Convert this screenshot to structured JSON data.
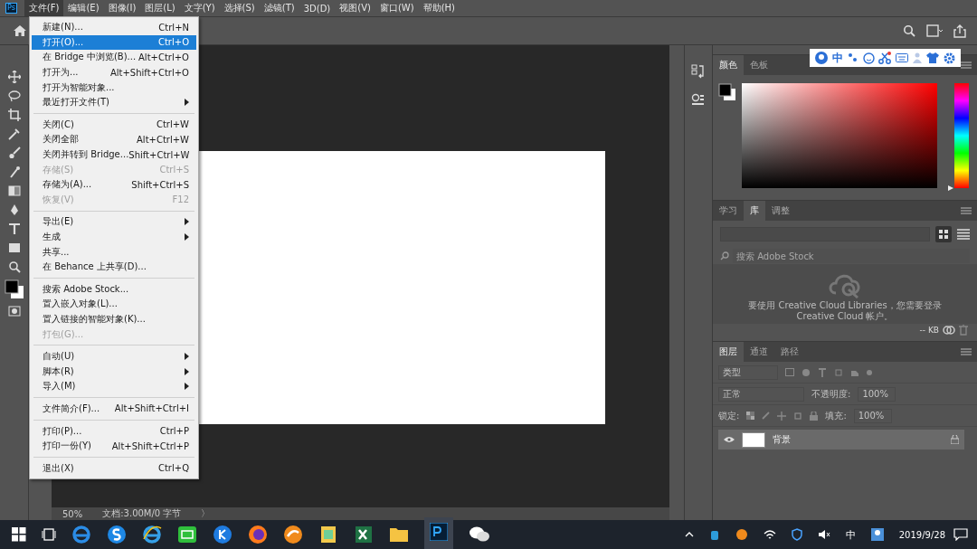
{
  "menubar": {
    "app_icon": "Ps",
    "items": [
      {
        "label": "文件(F)",
        "selected": true
      },
      {
        "label": "编辑(E)",
        "selected": false
      },
      {
        "label": "图像(I)",
        "selected": false
      },
      {
        "label": "图层(L)",
        "selected": false
      },
      {
        "label": "文字(Y)",
        "selected": false
      },
      {
        "label": "选择(S)",
        "selected": false
      },
      {
        "label": "滤镜(T)",
        "selected": false
      },
      {
        "label": "3D(D)",
        "selected": false
      },
      {
        "label": "视图(V)",
        "selected": false
      },
      {
        "label": "窗口(W)",
        "selected": false
      },
      {
        "label": "帮助(H)",
        "selected": false
      }
    ]
  },
  "file_menu": {
    "items": [
      {
        "kind": "item",
        "label": "新建(N)...",
        "shortcut": "Ctrl+N",
        "submenu": false,
        "disabled": false,
        "selected": false
      },
      {
        "kind": "item",
        "label": "打开(O)...",
        "shortcut": "Ctrl+O",
        "submenu": false,
        "disabled": false,
        "selected": true
      },
      {
        "kind": "item",
        "label": "在 Bridge 中浏览(B)...",
        "shortcut": "Alt+Ctrl+O",
        "submenu": false,
        "disabled": false,
        "selected": false
      },
      {
        "kind": "item",
        "label": "打开为...",
        "shortcut": "Alt+Shift+Ctrl+O",
        "submenu": false,
        "disabled": false,
        "selected": false
      },
      {
        "kind": "item",
        "label": "打开为智能对象...",
        "submenu": false,
        "disabled": false,
        "selected": false
      },
      {
        "kind": "item",
        "label": "最近打开文件(T)",
        "submenu": true,
        "disabled": false,
        "selected": false
      },
      {
        "kind": "separator"
      },
      {
        "kind": "item",
        "label": "关闭(C)",
        "shortcut": "Ctrl+W",
        "submenu": false,
        "disabled": false,
        "selected": false
      },
      {
        "kind": "item",
        "label": "关闭全部",
        "shortcut": "Alt+Ctrl+W",
        "submenu": false,
        "disabled": false,
        "selected": false
      },
      {
        "kind": "item",
        "label": "关闭并转到 Bridge...",
        "shortcut": "Shift+Ctrl+W",
        "submenu": false,
        "disabled": false,
        "selected": false
      },
      {
        "kind": "item",
        "label": "存储(S)",
        "shortcut": "Ctrl+S",
        "submenu": false,
        "disabled": true,
        "selected": false
      },
      {
        "kind": "item",
        "label": "存储为(A)...",
        "shortcut": "Shift+Ctrl+S",
        "submenu": false,
        "disabled": false,
        "selected": false
      },
      {
        "kind": "item",
        "label": "恢复(V)",
        "shortcut": "F12",
        "submenu": false,
        "disabled": true,
        "selected": false
      },
      {
        "kind": "separator"
      },
      {
        "kind": "item",
        "label": "导出(E)",
        "submenu": true,
        "disabled": false,
        "selected": false
      },
      {
        "kind": "item",
        "label": "生成",
        "submenu": true,
        "disabled": false,
        "selected": false
      },
      {
        "kind": "item",
        "label": "共享...",
        "submenu": false,
        "disabled": false,
        "selected": false
      },
      {
        "kind": "item",
        "label": "在 Behance 上共享(D)...",
        "submenu": false,
        "disabled": false,
        "selected": false
      },
      {
        "kind": "separator"
      },
      {
        "kind": "item",
        "label": "搜索 Adobe Stock...",
        "submenu": false,
        "disabled": false,
        "selected": false
      },
      {
        "kind": "item",
        "label": "置入嵌入对象(L)...",
        "submenu": false,
        "disabled": false,
        "selected": false
      },
      {
        "kind": "item",
        "label": "置入链接的智能对象(K)...",
        "submenu": false,
        "disabled": false,
        "selected": false
      },
      {
        "kind": "item",
        "label": "打包(G)...",
        "submenu": false,
        "disabled": true,
        "selected": false
      },
      {
        "kind": "separator"
      },
      {
        "kind": "item",
        "label": "自动(U)",
        "submenu": true,
        "disabled": false,
        "selected": false
      },
      {
        "kind": "item",
        "label": "脚本(R)",
        "submenu": true,
        "disabled": false,
        "selected": false
      },
      {
        "kind": "item",
        "label": "导入(M)",
        "submenu": true,
        "disabled": false,
        "selected": false
      },
      {
        "kind": "separator"
      },
      {
        "kind": "item",
        "label": "文件简介(F)...",
        "shortcut": "Alt+Shift+Ctrl+I",
        "submenu": false,
        "disabled": false,
        "selected": false
      },
      {
        "kind": "separator"
      },
      {
        "kind": "item",
        "label": "打印(P)...",
        "shortcut": "Ctrl+P",
        "submenu": false,
        "disabled": false,
        "selected": false
      },
      {
        "kind": "item",
        "label": "打印一份(Y)",
        "shortcut": "Alt+Shift+Ctrl+P",
        "submenu": false,
        "disabled": false,
        "selected": false
      },
      {
        "kind": "separator"
      },
      {
        "kind": "item",
        "label": "退出(X)",
        "shortcut": "Ctrl+Q",
        "submenu": false,
        "disabled": false,
        "selected": false
      }
    ]
  },
  "status_bar": {
    "zoom": "50%",
    "doc_info": "文档:3.00M/0 字节",
    "arrow": "〉"
  },
  "ime_toolbar": {
    "mode": "中"
  },
  "color_panel": {
    "tabs": [
      {
        "label": "颜色",
        "selected": true
      },
      {
        "label": "色板",
        "selected": false
      }
    ],
    "hue_slider": {
      "level": 0
    }
  },
  "library_panel": {
    "tabs": [
      {
        "label": "学习",
        "selected": false
      },
      {
        "label": "库",
        "selected": true
      },
      {
        "label": "调整",
        "selected": false
      }
    ],
    "search": {
      "placeholder": "搜索 Adobe Stock"
    },
    "message": "要使用 Creative Cloud Libraries，您需要登录 Creative Cloud 帐户。",
    "size": "-- KB"
  },
  "layers_panel": {
    "tabs": [
      {
        "label": "图层",
        "selected": true
      },
      {
        "label": "通道",
        "selected": false
      },
      {
        "label": "路径",
        "selected": false
      }
    ],
    "filter": "类型",
    "blend_mode": "正常",
    "opacity_label": "不透明度:",
    "opacity": "100%",
    "lock_label": "锁定:",
    "fill_label": "填充:",
    "fill": "100%",
    "layers": [
      {
        "name": "背景",
        "visible": true,
        "locked": true,
        "selected": true
      }
    ]
  },
  "taskbar": {
    "ime": "中",
    "date": "2019/9/28"
  }
}
